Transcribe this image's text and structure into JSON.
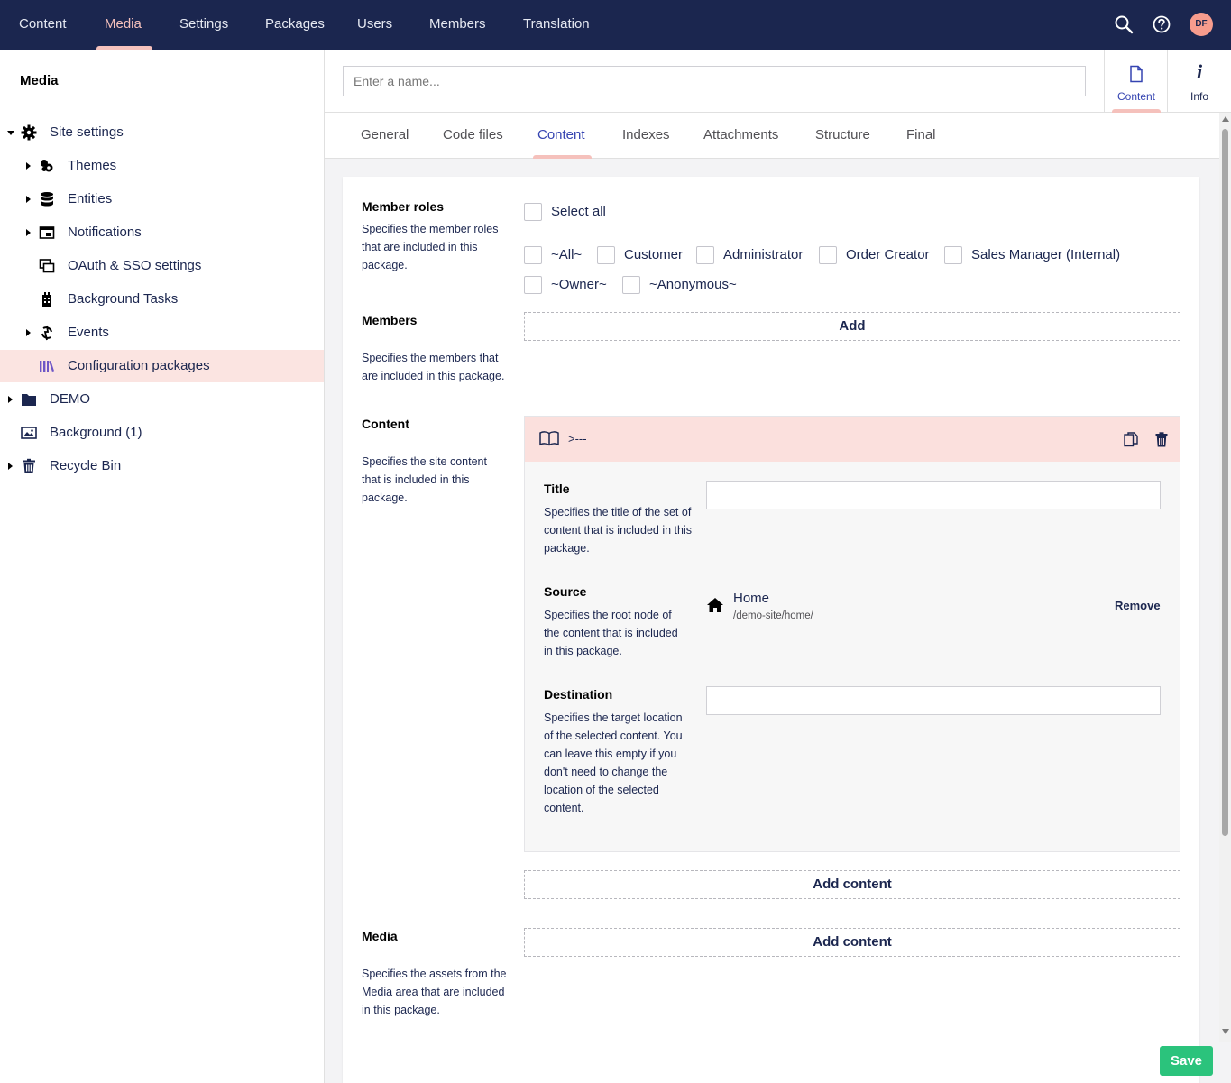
{
  "topnav": {
    "items": [
      "Content",
      "Media",
      "Settings",
      "Packages",
      "Users",
      "Members",
      "Translation"
    ],
    "active": "Media",
    "avatar_initials": "DF",
    "icons": [
      "search-icon",
      "help-icon"
    ]
  },
  "sidebar": {
    "title": "Media",
    "items": [
      {
        "label": "Site settings",
        "icon": "gear-icon",
        "expanded": true
      },
      {
        "label": "Themes",
        "icon": "palette-icon"
      },
      {
        "label": "Entities",
        "icon": "database-icon"
      },
      {
        "label": "Notifications",
        "icon": "notification-icon"
      },
      {
        "label": "OAuth & SSO settings",
        "icon": "windows-icon"
      },
      {
        "label": "Background Tasks",
        "icon": "tasks-icon"
      },
      {
        "label": "Events",
        "icon": "events-icon"
      },
      {
        "label": "Configuration packages",
        "icon": "books-icon",
        "active": true
      },
      {
        "label": "DEMO",
        "icon": "folder-icon"
      },
      {
        "label": "Background (1)",
        "icon": "image-icon"
      },
      {
        "label": "Recycle Bin",
        "icon": "trash-icon"
      }
    ]
  },
  "header": {
    "name_placeholder": "Enter a name...",
    "apps": [
      {
        "label": "Content",
        "active": true
      },
      {
        "label": "Info"
      }
    ]
  },
  "tabs": [
    "General",
    "Code files",
    "Content",
    "Indexes",
    "Attachments",
    "Structure",
    "Final"
  ],
  "active_tab": "Content",
  "member_roles": {
    "label": "Member roles",
    "description": "Specifies the member roles that are included in this package.",
    "select_all": "Select all",
    "roles": [
      "~All~",
      "Customer",
      "Administrator",
      "Order Creator",
      "Sales Manager (Internal)",
      "~Owner~",
      "~Anonymous~"
    ]
  },
  "members": {
    "label": "Members",
    "description": "Specifies the members that are included in this package.",
    "add_label": "Add"
  },
  "content": {
    "label": "Content",
    "description": "Specifies the site content that is included in this package.",
    "block": {
      "name": ">---",
      "title_label": "Title",
      "title_desc": "Specifies the title of the set of content that is included in this package.",
      "title_value": "",
      "source_label": "Source",
      "source_desc": "Specifies the root node of the content that is included in this package.",
      "source_name": "Home",
      "source_path": "/demo-site/home/",
      "remove_label": "Remove",
      "destination_label": "Destination",
      "destination_desc": "Specifies the target location of the selected content. You can leave this empty if you don't need to change the location of the selected content.",
      "destination_value": ""
    },
    "add_label": "Add content"
  },
  "media": {
    "label": "Media",
    "description": "Specifies the assets from the Media area that are included in this package.",
    "add_label": "Add content"
  },
  "save_label": "Save",
  "colors": {
    "nav_bg": "#1b264f",
    "accent": "#f5c1bc",
    "save": "#2bc37c",
    "active_tab": "#3544b1"
  }
}
